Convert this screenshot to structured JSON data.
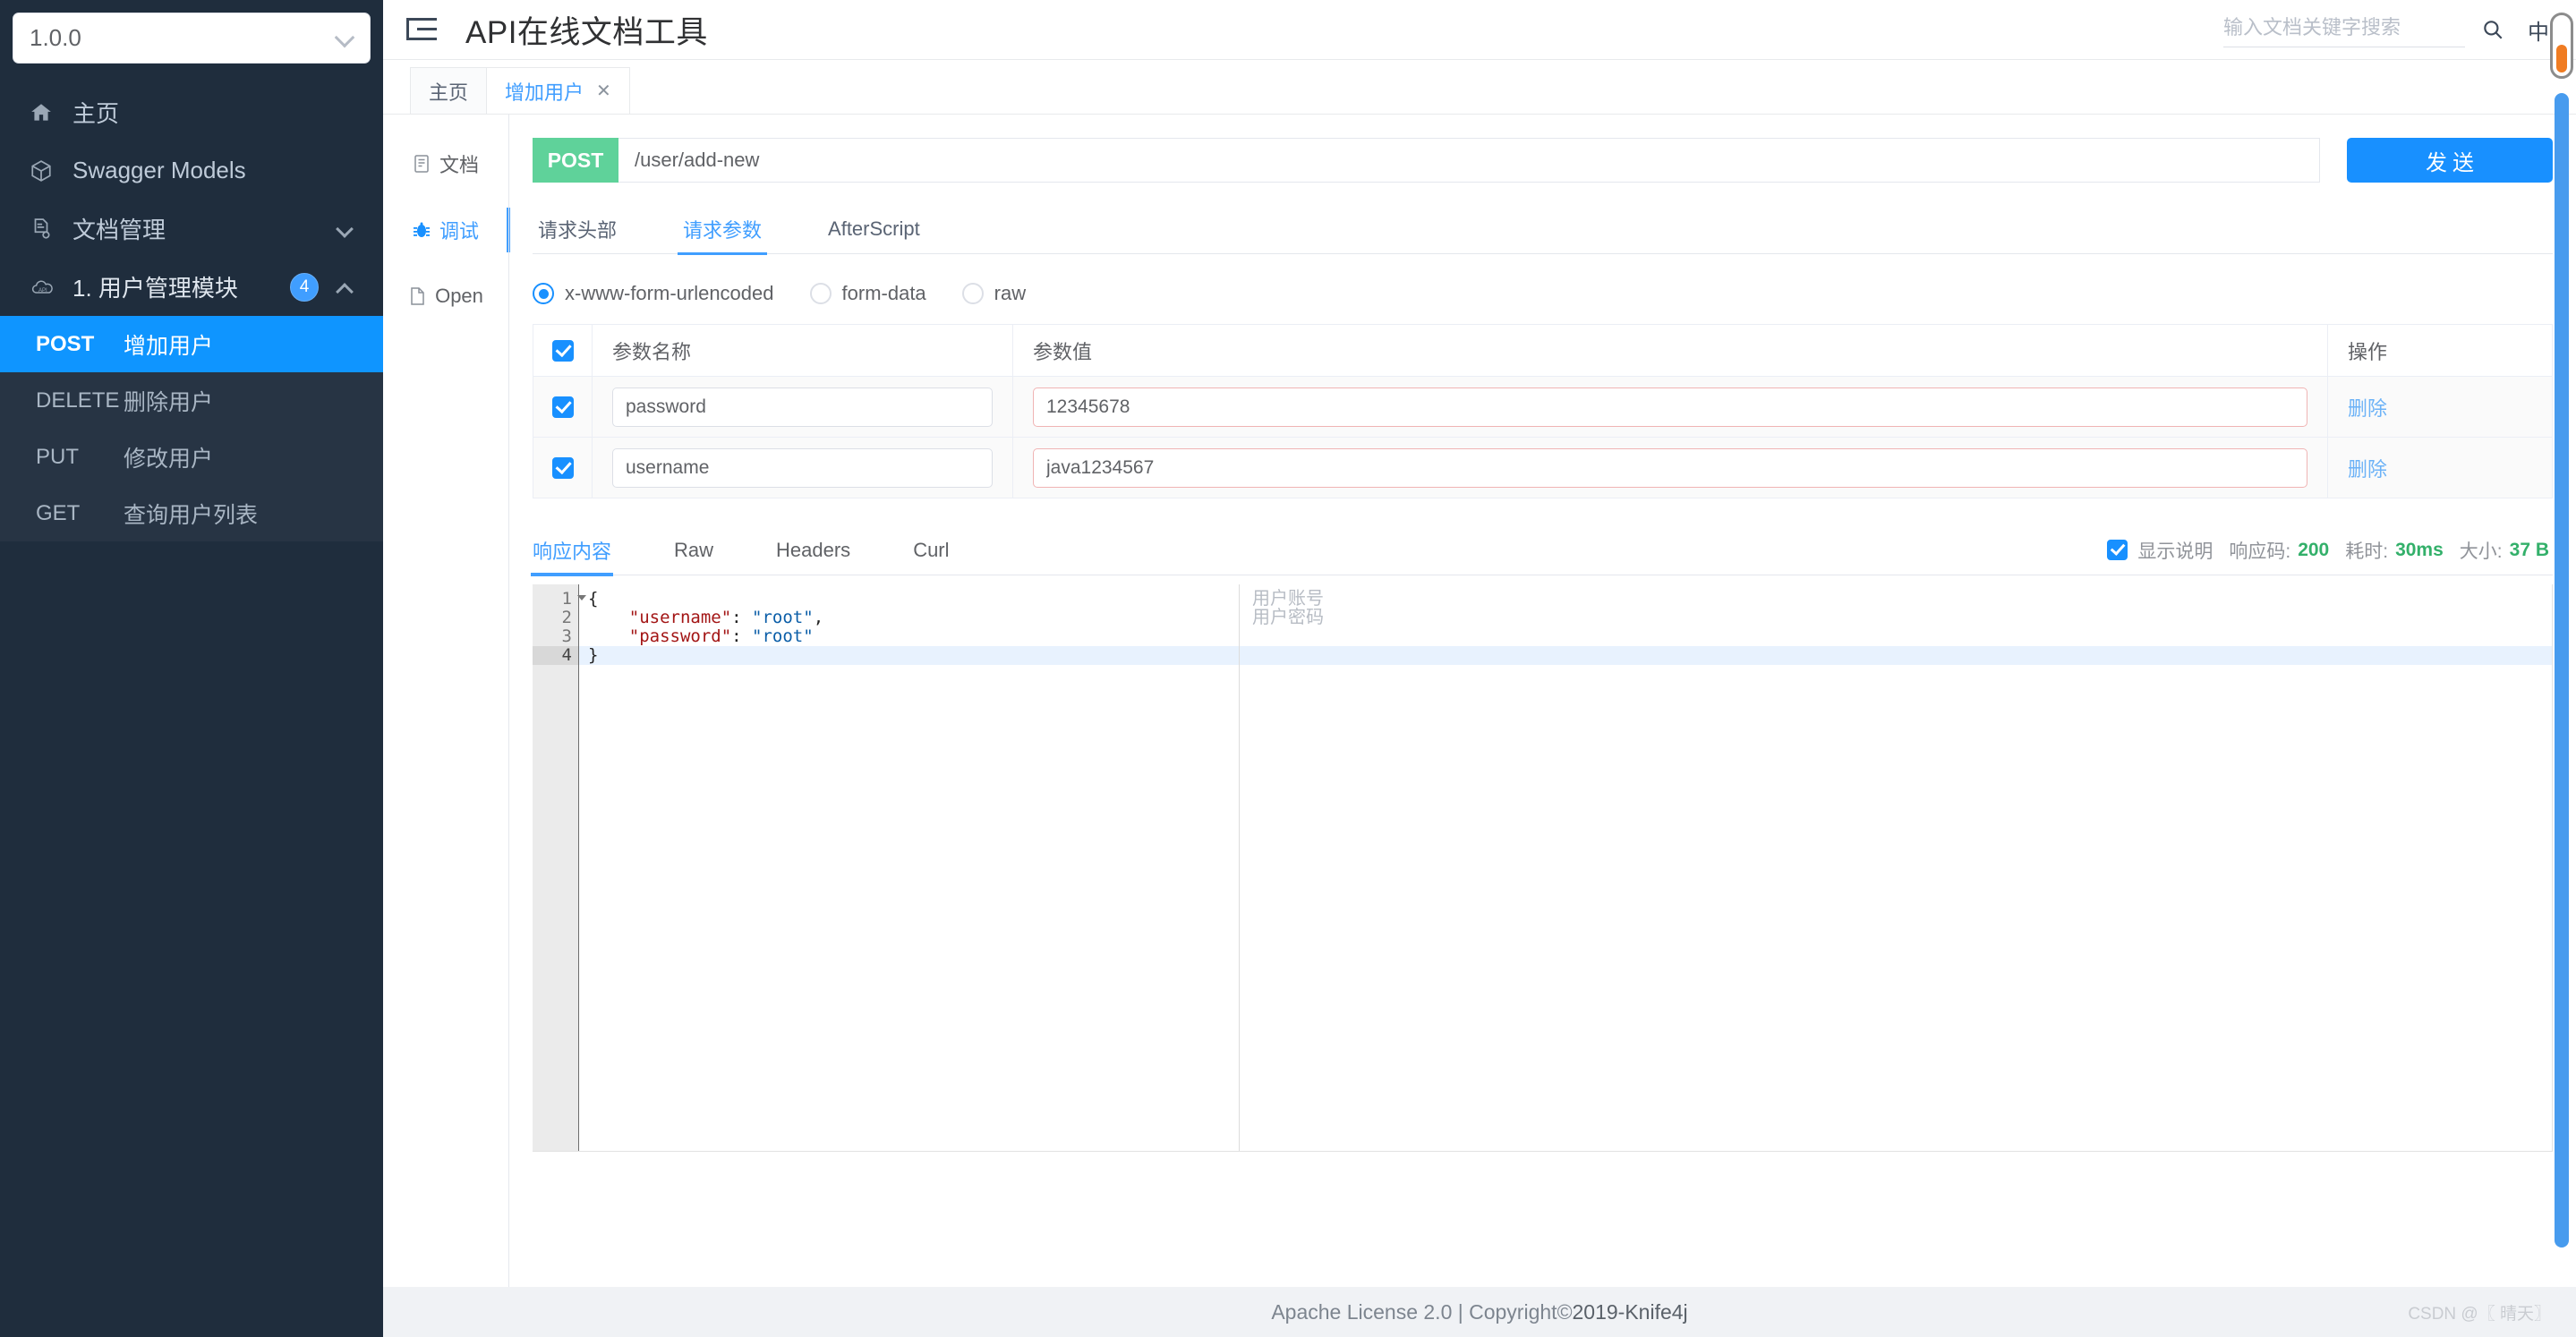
{
  "sidebar": {
    "version": {
      "value": "1.0.0",
      "caret_icon": "chevron-down-icon"
    },
    "items": [
      {
        "label": "主页",
        "icon": "home-icon"
      },
      {
        "label": "Swagger Models",
        "icon": "cube-icon"
      },
      {
        "label": "文档管理",
        "icon": "document-settings-icon",
        "chevron": "chevron-down-icon"
      },
      {
        "label": "1. 用户管理模块",
        "icon": "api-cloud-icon",
        "badge": "4",
        "chevron": "chevron-up-icon"
      }
    ],
    "endpoints": [
      {
        "method": "POST",
        "name": "增加用户",
        "active": true
      },
      {
        "method": "DELETE",
        "name": "删除用户",
        "active": false
      },
      {
        "method": "PUT",
        "name": "修改用户",
        "active": false
      },
      {
        "method": "GET",
        "name": "查询用户列表",
        "active": false
      }
    ]
  },
  "header": {
    "menu_icon": "hamburger-menu-icon",
    "title": "API在线文档工具",
    "search_placeholder": "输入文档关键字搜索",
    "search_value": "",
    "search_icon": "search-icon",
    "lang_label": "中"
  },
  "doc_tabs": [
    {
      "label": "主页",
      "active": false,
      "closable": false
    },
    {
      "label": "增加用户",
      "active": true,
      "closable": true,
      "close_label": "✕"
    }
  ],
  "vtabs": [
    {
      "label": "文档",
      "icon": "document-icon",
      "active": false
    },
    {
      "label": "调试",
      "icon": "bug-icon",
      "active": true
    },
    {
      "label": "Open",
      "icon": "file-icon",
      "active": false
    }
  ],
  "request": {
    "method": "POST",
    "url": "/user/add-new",
    "url_placeholder": "",
    "send_label": "发送",
    "tabs": [
      {
        "label": "请求头部",
        "active": false
      },
      {
        "label": "请求参数",
        "active": true
      },
      {
        "label": "AfterScript",
        "active": false
      }
    ],
    "body_types": [
      {
        "label": "x-www-form-urlencoded",
        "checked": true
      },
      {
        "label": "form-data",
        "checked": false
      },
      {
        "label": "raw",
        "checked": false
      }
    ],
    "table": {
      "headers": {
        "name": "参数名称",
        "value": "参数值",
        "op": "操作"
      },
      "rows": [
        {
          "checked": true,
          "name": "password",
          "value": "12345678",
          "op": "删除"
        },
        {
          "checked": true,
          "name": "username",
          "value": "java1234567",
          "op": "删除"
        }
      ]
    }
  },
  "response": {
    "tabs": [
      {
        "label": "响应内容",
        "active": true
      },
      {
        "label": "Raw",
        "active": false
      },
      {
        "label": "Headers",
        "active": false
      },
      {
        "label": "Curl",
        "active": false
      }
    ],
    "show_desc_label": "显示说明",
    "show_desc_checked": true,
    "status_label": "响应码:",
    "status_value": "200",
    "time_label": "耗时:",
    "time_value": "30ms",
    "size_label": "大小:",
    "size_value": "37 B",
    "editor": {
      "lines": [
        {
          "n": "1",
          "fold": true,
          "current": false,
          "parts": [
            {
              "t": "pun",
              "s": "{"
            }
          ]
        },
        {
          "n": "2",
          "fold": false,
          "current": false,
          "parts": [
            {
              "t": "key",
              "s": "    \"username\""
            },
            {
              "t": "pun",
              "s": ": "
            },
            {
              "t": "str",
              "s": "\"root\""
            },
            {
              "t": "pun",
              "s": ","
            }
          ]
        },
        {
          "n": "3",
          "fold": false,
          "current": false,
          "parts": [
            {
              "t": "key",
              "s": "    \"password\""
            },
            {
              "t": "pun",
              "s": ": "
            },
            {
              "t": "str",
              "s": "\"root\""
            }
          ]
        },
        {
          "n": "4",
          "fold": false,
          "current": true,
          "parts": [
            {
              "t": "pun",
              "s": "}"
            }
          ]
        }
      ],
      "annotations": [
        "用户账号",
        "用户密码"
      ]
    }
  },
  "footer": {
    "license": "Apache License 2.0 | Copyright ",
    "copyright_icon": "©",
    "years": " 2019-Knife4j",
    "watermark": "CSDN @〖 晴天〗"
  },
  "colors": {
    "sidebar_bg": "#1f2d3d",
    "active_blue": "#0f95ff",
    "primary": "#409eff",
    "post_green": "#5fd29a",
    "send_blue": "#1890ff",
    "status_green": "#33b06a",
    "scroll_orange": "#f07c22"
  }
}
